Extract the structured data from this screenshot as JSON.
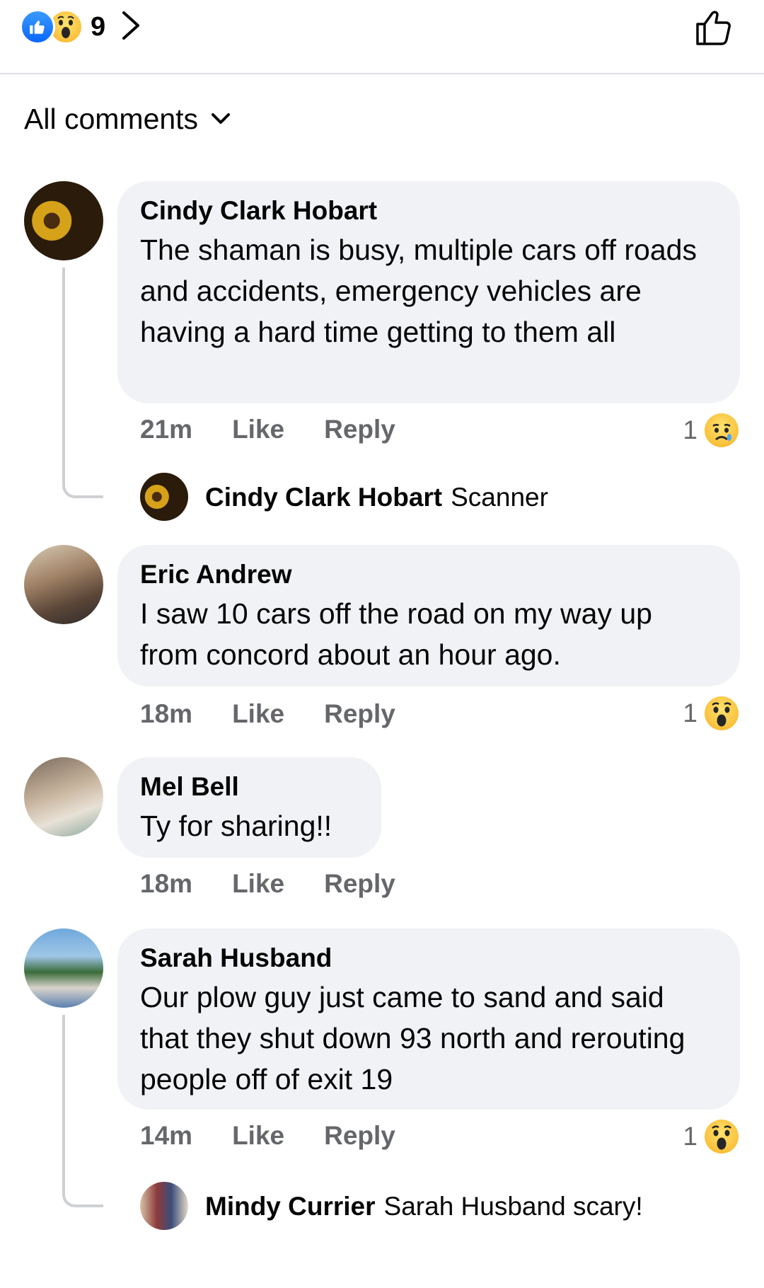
{
  "reactions": {
    "count": "9",
    "types": [
      "like-icon",
      "wow-icon"
    ],
    "like_color": "#0866ff",
    "wow_color": "#f7b125"
  },
  "filter": {
    "label": "All comments"
  },
  "comments": [
    {
      "author": "Cindy Clark Hobart",
      "text": "The shaman is busy, multiple cars off roads and accidents, emergency vehicles are  having a hard time getting to them all",
      "time": "21m",
      "like_label": "Like",
      "reply_label": "Reply",
      "reaction_count": "1",
      "reaction_icon": "sad-icon",
      "reply_preview": {
        "author": "Cindy Clark Hobart",
        "text": "Scanner"
      }
    },
    {
      "author": "Eric Andrew",
      "text": "I saw 10 cars off the road on my way up from concord about an hour ago.",
      "time": "18m",
      "like_label": "Like",
      "reply_label": "Reply",
      "reaction_count": "1",
      "reaction_icon": "wow-icon"
    },
    {
      "author": "Mel Bell",
      "text": "Ty for sharing!!",
      "time": "18m",
      "like_label": "Like",
      "reply_label": "Reply"
    },
    {
      "author": "Sarah Husband",
      "text": "Our plow guy just came to sand and said that they shut down 93 north and rerouting people off of exit 19",
      "time": "14m",
      "like_label": "Like",
      "reply_label": "Reply",
      "reaction_count": "1",
      "reaction_icon": "wow-icon",
      "reply_preview": {
        "author": "Mindy Currier",
        "text": "Sarah Husband scary!"
      }
    }
  ]
}
